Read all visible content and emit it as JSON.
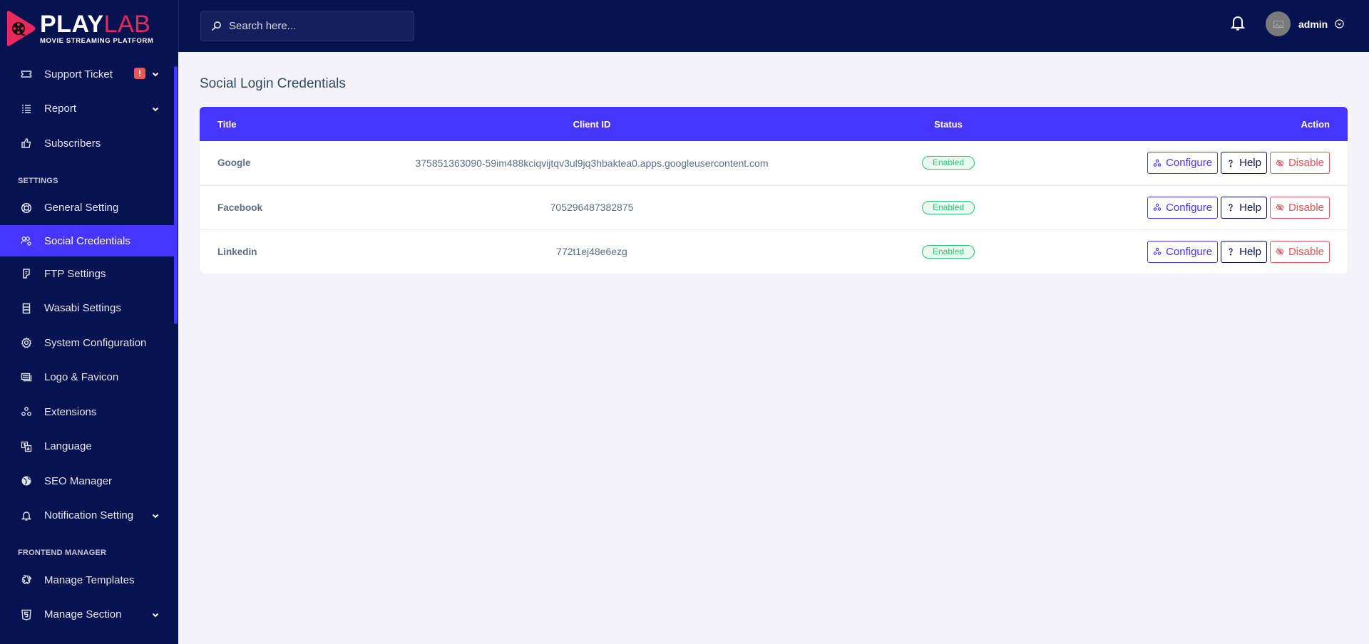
{
  "brand": {
    "name_primary": "PLAY",
    "name_secondary": "LAB",
    "tagline": "MOVIE STREAMING PLATFORM",
    "colors": {
      "accent": "#4634ff",
      "navy": "#071251",
      "brand_pink": "#e7295b",
      "success": "#28c76f",
      "danger": "#ea5455"
    }
  },
  "sidebar": {
    "items_top": [
      {
        "label": "Support Ticket",
        "icon": "ticket-icon",
        "has_caret": true,
        "alert_badge": "!"
      },
      {
        "label": "Report",
        "icon": "list-icon",
        "has_caret": true
      },
      {
        "label": "Subscribers",
        "icon": "thumbs-up-icon"
      }
    ],
    "section_settings": "SETTINGS",
    "items_settings": [
      {
        "label": "General Setting",
        "icon": "life-ring-icon"
      },
      {
        "label": "Social Credentials",
        "icon": "users-gear-icon",
        "active": true
      },
      {
        "label": "FTP Settings",
        "icon": "ftp-icon"
      },
      {
        "label": "Wasabi Settings",
        "icon": "server-icon"
      },
      {
        "label": "System Configuration",
        "icon": "gear-icon"
      },
      {
        "label": "Logo & Favicon",
        "icon": "images-icon"
      },
      {
        "label": "Extensions",
        "icon": "cubes-icon"
      },
      {
        "label": "Language",
        "icon": "language-icon"
      },
      {
        "label": "SEO Manager",
        "icon": "globe-icon"
      },
      {
        "label": "Notification Setting",
        "icon": "bell-icon",
        "has_caret": true
      }
    ],
    "section_frontend": "FRONTEND MANAGER",
    "items_frontend": [
      {
        "label": "Manage Templates",
        "icon": "puzzle-icon"
      },
      {
        "label": "Manage Section",
        "icon": "html5-icon",
        "has_caret": true
      }
    ]
  },
  "topbar": {
    "search_placeholder": "Search here...",
    "username": "admin"
  },
  "page": {
    "title": "Social Login Credentials",
    "table": {
      "columns": [
        "Title",
        "Client ID",
        "Status",
        "Action"
      ],
      "rows": [
        {
          "title": "Google",
          "client_id": "375851363090-59im488kciqvijtqv3ul9jq3hbaktea0.apps.googleusercontent.com",
          "status": "Enabled"
        },
        {
          "title": "Facebook",
          "client_id": "705296487382875",
          "status": "Enabled"
        },
        {
          "title": "Linkedin",
          "client_id": "772t1ej48e6ezg",
          "status": "Enabled"
        }
      ],
      "actions": {
        "configure": "Configure",
        "help": "Help",
        "disable": "Disable"
      }
    }
  }
}
